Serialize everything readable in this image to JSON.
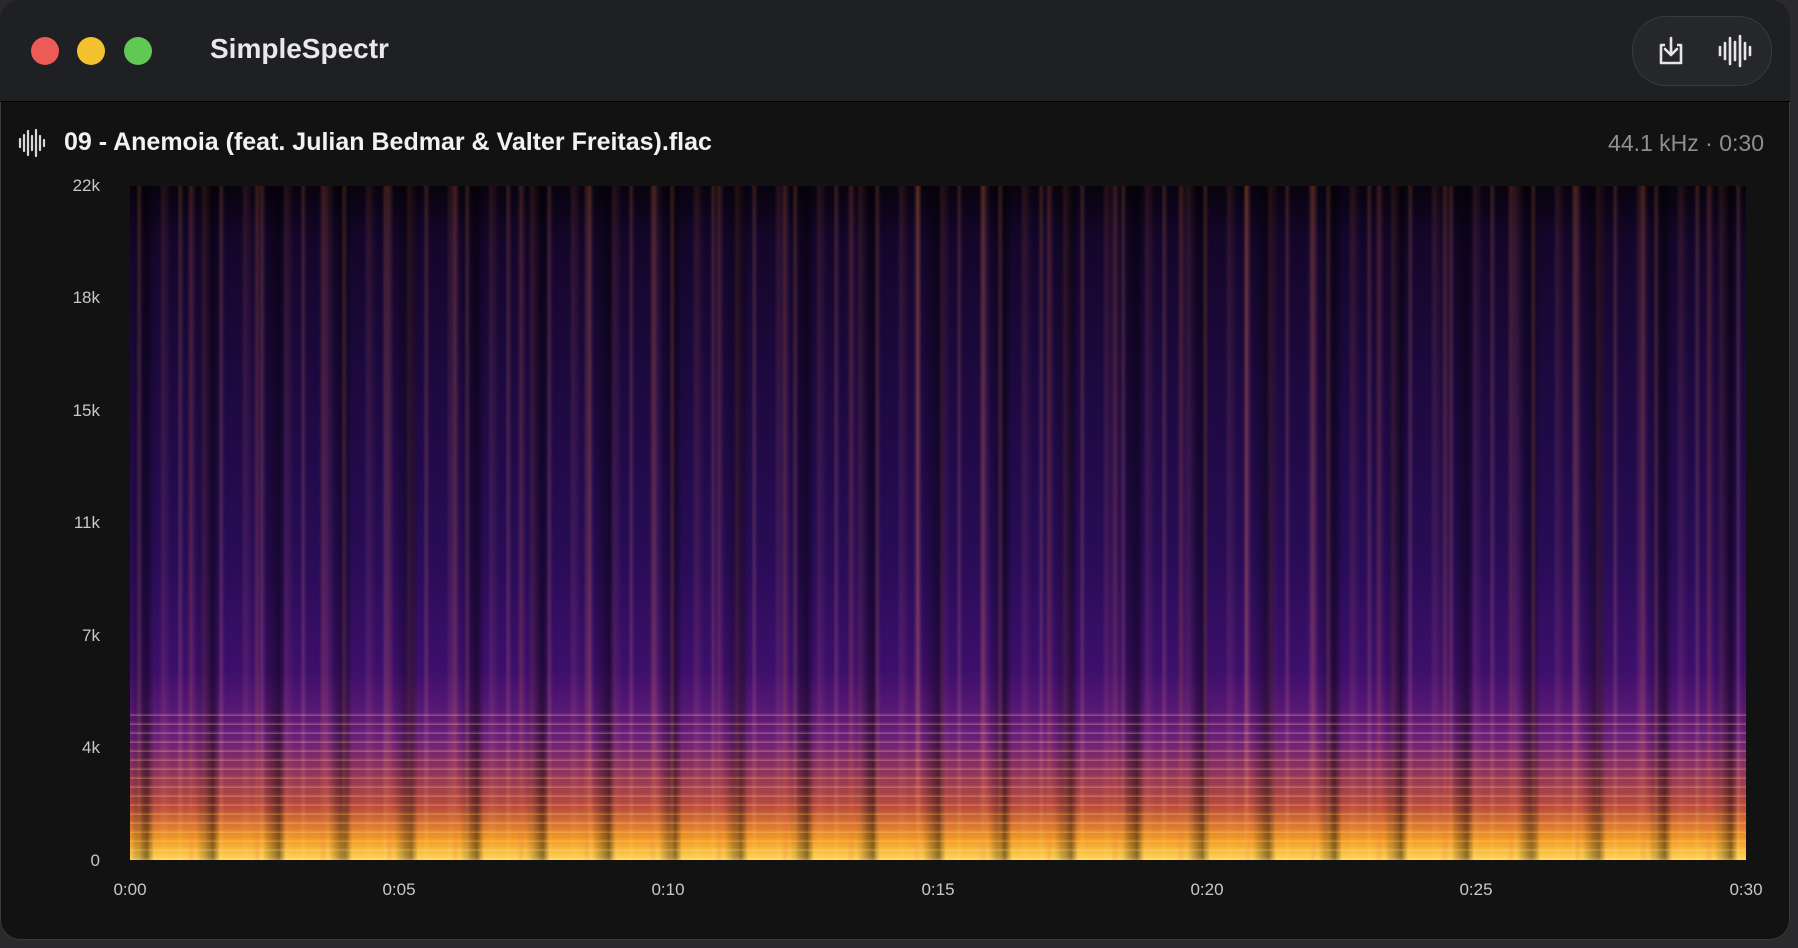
{
  "app": {
    "title": "SimpleSpectr"
  },
  "toolbar": {
    "export_icon": "download-tray-icon",
    "waveform_icon": "waveform-icon"
  },
  "file": {
    "name": "09 - Anemoia (feat. Julian Bedmar & Valter Freitas).flac",
    "meta": "44.1 kHz · 0:30",
    "icon": "waveform-icon"
  },
  "spectrogram": {
    "y_ticks": [
      "22k",
      "18k",
      "15k",
      "11k",
      "7k",
      "4k",
      "0"
    ],
    "x_ticks": [
      "0:00",
      "0:05",
      "0:10",
      "0:15",
      "0:20",
      "0:25",
      "0:30"
    ],
    "colormap": [
      "#08030f",
      "#280c56",
      "#6a1f7a",
      "#f29a28",
      "#ffd457"
    ]
  }
}
